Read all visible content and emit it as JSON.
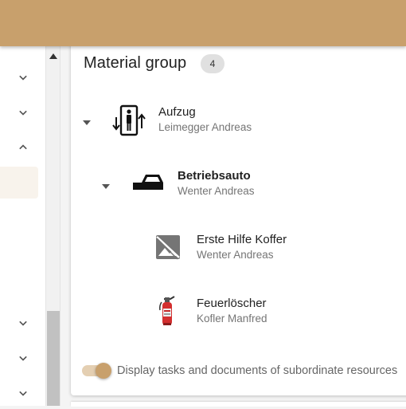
{
  "card": {
    "title": "Material group",
    "count": "4"
  },
  "tree": [
    {
      "title": "Aufzug",
      "subtitle": "Leimegger Andreas",
      "icon": "elevator-icon",
      "expanded": true
    },
    {
      "title": "Betriebsauto",
      "subtitle": "Wenter Andreas",
      "icon": "car-icon",
      "expanded": true
    },
    {
      "title": "Erste Hilfe Koffer",
      "subtitle": "Wenter Andreas",
      "icon": "image-placeholder-icon"
    },
    {
      "title": "Feuerlöscher",
      "subtitle": "Kofler Manfred",
      "icon": "fire-extinguisher-icon"
    }
  ],
  "toggle": {
    "label": "Display tasks and documents of subordinate resources",
    "on": true
  },
  "colors": {
    "brand": "#c8a06c",
    "toggle_track": "#e4cfb2",
    "active_item_bg": "#f8f3ec"
  }
}
